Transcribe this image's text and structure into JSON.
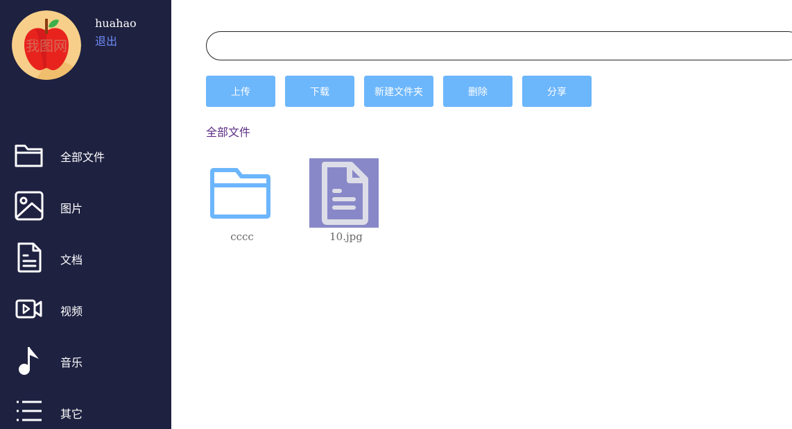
{
  "user": {
    "name": "huahao",
    "logout_label": "退出",
    "avatar_watermark": "我图网"
  },
  "sidebar": {
    "items": [
      {
        "label": "全部文件",
        "icon": "folder-icon"
      },
      {
        "label": "图片",
        "icon": "image-icon"
      },
      {
        "label": "文档",
        "icon": "document-icon"
      },
      {
        "label": "视频",
        "icon": "video-icon"
      },
      {
        "label": "音乐",
        "icon": "music-note-icon"
      },
      {
        "label": "其它",
        "icon": "list-icon"
      }
    ]
  },
  "search": {
    "value": "",
    "placeholder": ""
  },
  "toolbar": {
    "upload_label": "上传",
    "download_label": "下载",
    "new_folder_label": "新建文件夹",
    "delete_label": "删除",
    "share_label": "分享"
  },
  "breadcrumb": {
    "label": "全部文件"
  },
  "files": [
    {
      "name": "cccc",
      "type": "folder",
      "icon": "folder-icon"
    },
    {
      "name": "10.jpg",
      "type": "file",
      "icon": "document-icon"
    }
  ],
  "colors": {
    "sidebar_bg": "#1e2140",
    "button_bg": "#6cb6fc",
    "logout": "#6f8cf5",
    "breadcrumb": "#5a2a82",
    "folder": "#6cb6fc",
    "file_thumb_bg": "#8888c8"
  }
}
